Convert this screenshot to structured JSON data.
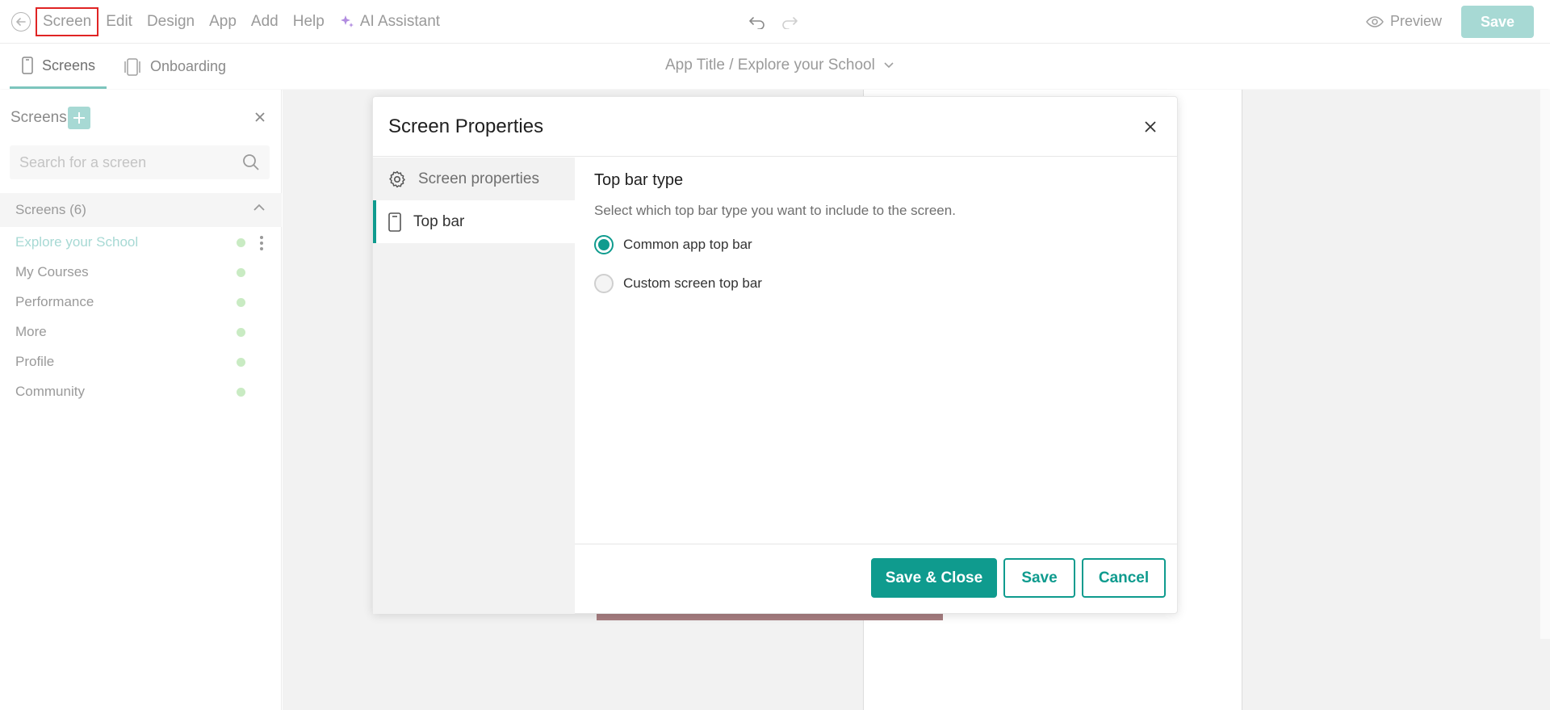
{
  "menubar": {
    "items": [
      {
        "label": "Screen"
      },
      {
        "label": "Edit"
      },
      {
        "label": "Design"
      },
      {
        "label": "App"
      },
      {
        "label": "Add"
      },
      {
        "label": "Help"
      }
    ],
    "ai_label": "AI Assistant",
    "preview_label": "Preview",
    "save_label": "Save"
  },
  "subbar": {
    "tabs": [
      {
        "label": "Screens"
      },
      {
        "label": "Onboarding"
      }
    ],
    "app_title": "App Title / Explore your School"
  },
  "sidebar": {
    "title": "Screens",
    "search_placeholder": "Search for a screen",
    "group_label": "Screens (6)",
    "screens": [
      {
        "name": "Explore your School"
      },
      {
        "name": "My Courses"
      },
      {
        "name": "Performance"
      },
      {
        "name": "More"
      },
      {
        "name": "Profile"
      },
      {
        "name": "Community"
      }
    ]
  },
  "modal": {
    "title": "Screen Properties",
    "nav": [
      {
        "label": "Screen properties"
      },
      {
        "label": "Top bar"
      }
    ],
    "section_title": "Top bar type",
    "section_desc": "Select which top bar type you want to include to the screen.",
    "options": [
      {
        "label": "Common app top bar"
      },
      {
        "label": "Custom screen top bar"
      }
    ],
    "selected_option": "Common app top bar",
    "buttons": {
      "save_close": "Save & Close",
      "save": "Save",
      "cancel": "Cancel"
    }
  },
  "colors": {
    "accent": "#0f9b8e",
    "accent_light": "#a7d9d4",
    "status_dot": "#c9ebc3",
    "highlight_border": "#e02424"
  }
}
